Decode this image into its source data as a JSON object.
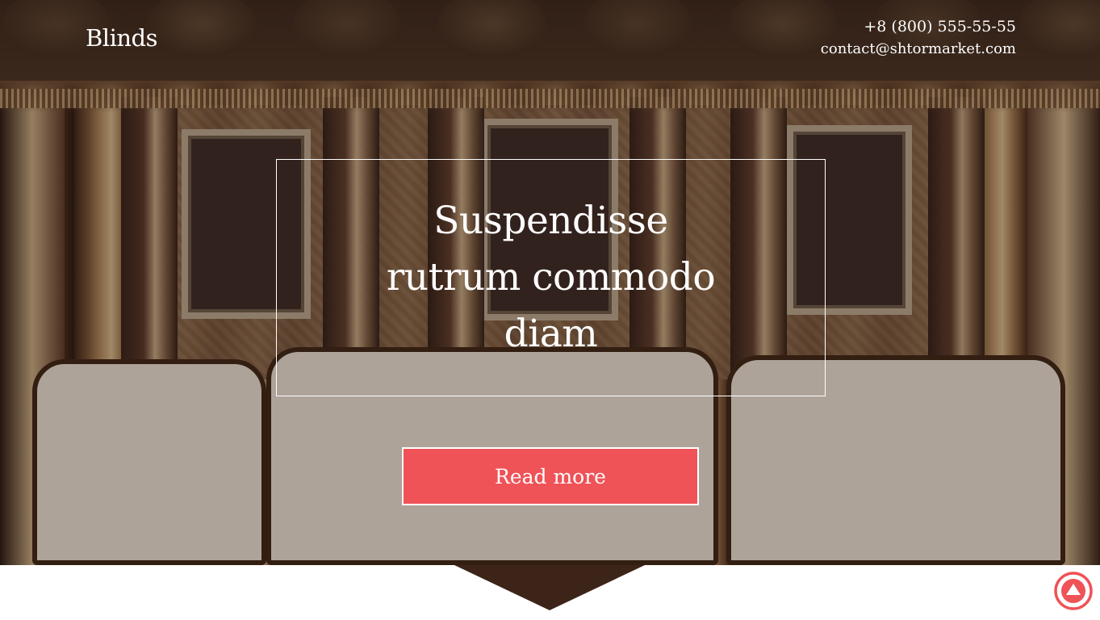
{
  "header": {
    "logo": "Blinds",
    "phone": "+8 (800) 555-55-55",
    "email": "contact@shtormarket.com"
  },
  "hero": {
    "title": "Suspendisse rutrum commodo diam",
    "cta_label": "Read more",
    "cta_color": "#ef5257"
  },
  "icons": {
    "scroll_top": "arrow-up-circle-icon"
  },
  "colors": {
    "accent": "#ef5257",
    "text": "#ffffff"
  }
}
